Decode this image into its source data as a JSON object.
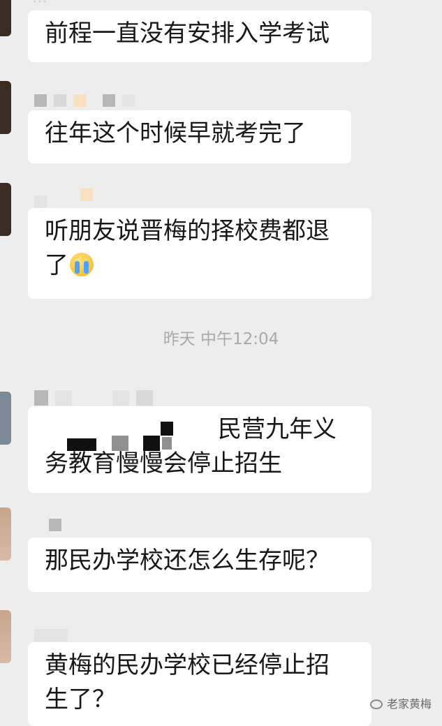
{
  "chat": {
    "timestamp": "昨天 中午12:04",
    "messages": [
      {
        "text": "前程一直没有安排入学考试"
      },
      {
        "text": "往年这个时候早就考完了"
      },
      {
        "text_line1": "听朋友说晋梅的择校费都退",
        "text_line2": "了"
      },
      {
        "text_line1": "民营九年义",
        "text_line2": "务教育慢慢会停止招生"
      },
      {
        "text": "那民办学校还怎么生存呢？"
      },
      {
        "text_line1": "黄梅的民办学校已经停止招",
        "text_line2": "生了？"
      }
    ]
  },
  "watermark": {
    "text": "老家黄梅"
  },
  "icons": {
    "emoji": "crying-face-icon",
    "watermark": "wechat-logo-icon"
  }
}
